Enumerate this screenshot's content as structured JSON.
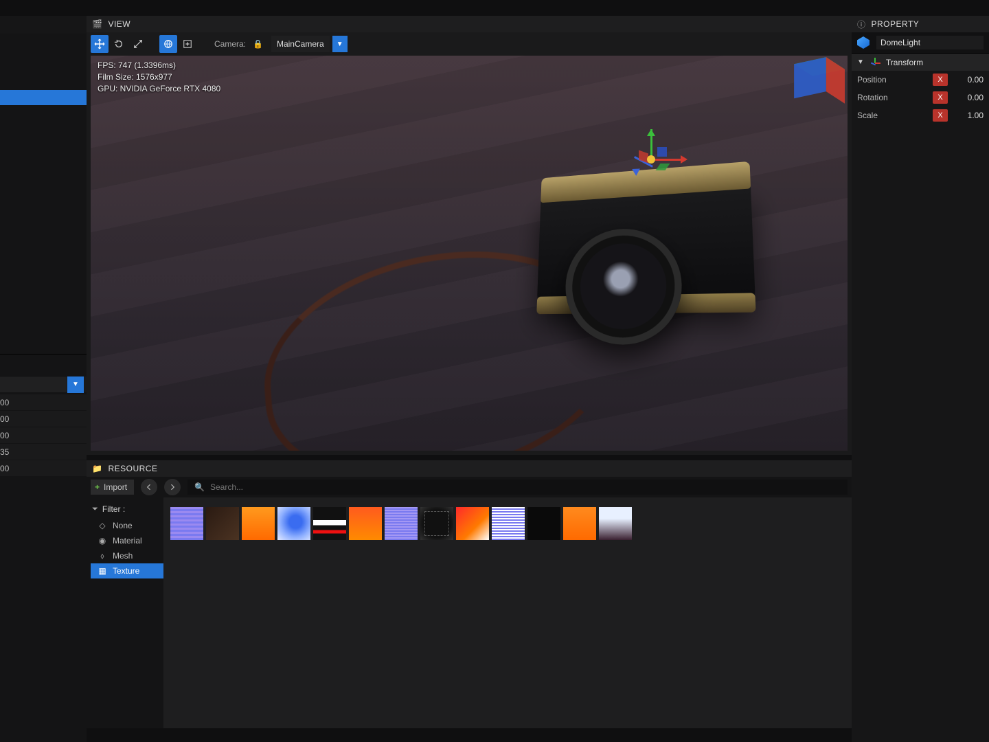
{
  "view": {
    "title": "VIEW",
    "camera_label": "Camera:",
    "camera_name": "MainCamera",
    "fps_line": "FPS: 747 (1.3396ms)",
    "film_line": "Film Size: 1576x977",
    "gpu_line": "GPU: NVIDIA GeForce RTX 4080"
  },
  "resource": {
    "title": "RESOURCE",
    "import_label": "Import",
    "search_placeholder": "Search...",
    "filter_title": "Filter :",
    "filters": {
      "none": "None",
      "material": "Material",
      "mesh": "Mesh",
      "texture": "Texture"
    }
  },
  "property": {
    "title": "PROPERTY",
    "object_name": "DomeLight",
    "section": "Transform",
    "rows": {
      "position": {
        "label": "Position",
        "axis": "X",
        "value": "0.00"
      },
      "rotation": {
        "label": "Rotation",
        "axis": "X",
        "value": "0.00"
      },
      "scale": {
        "label": "Scale",
        "axis": "X",
        "value": "1.00"
      }
    }
  },
  "left_fields": {
    "v1": "00",
    "v2": "00",
    "v3": "00",
    "v4": "35",
    "v5": "00"
  }
}
